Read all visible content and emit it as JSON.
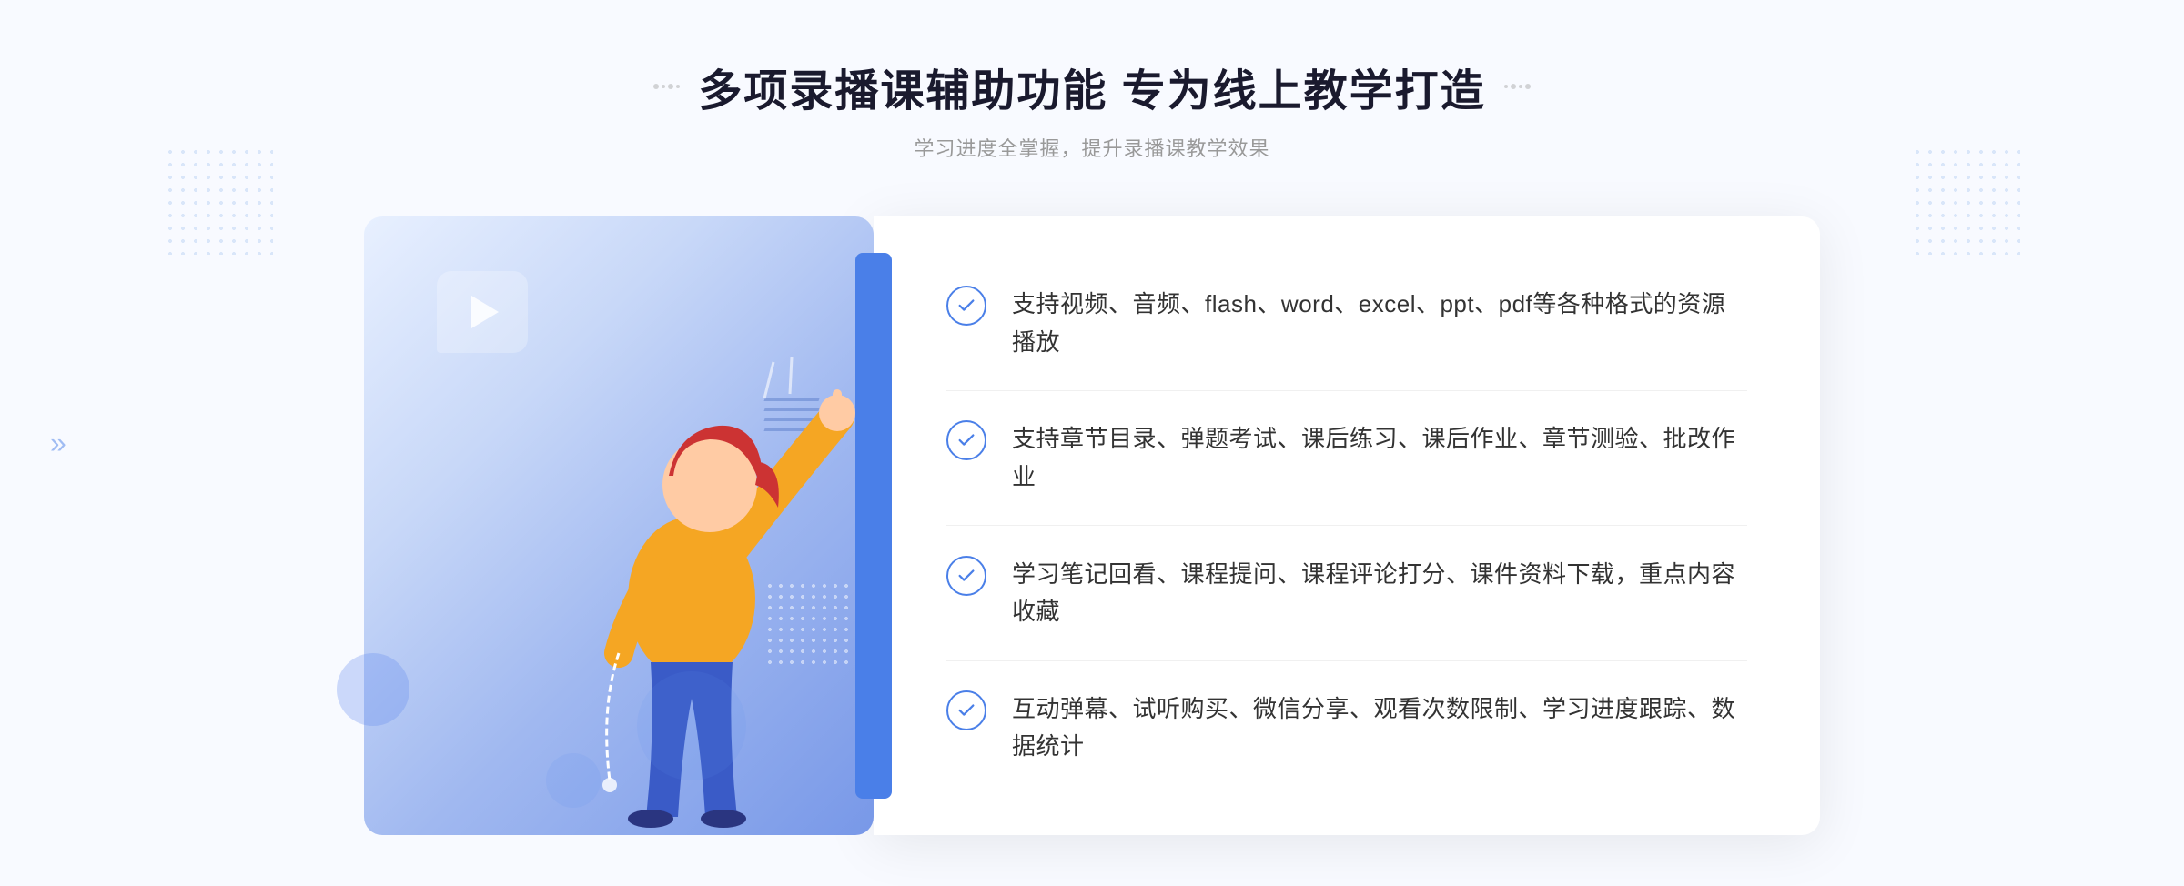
{
  "page": {
    "background": "#f8faff"
  },
  "header": {
    "title": "多项录播课辅助功能 专为线上教学打造",
    "subtitle": "学习进度全掌握，提升录播课教学效果"
  },
  "features": [
    {
      "id": 1,
      "text": "支持视频、音频、flash、word、excel、ppt、pdf等各种格式的资源播放"
    },
    {
      "id": 2,
      "text": "支持章节目录、弹题考试、课后练习、课后作业、章节测验、批改作业"
    },
    {
      "id": 3,
      "text": "学习笔记回看、课程提问、课程评论打分、课件资料下载，重点内容收藏"
    },
    {
      "id": 4,
      "text": "互动弹幕、试听购买、微信分享、观看次数限制、学习进度跟踪、数据统计"
    }
  ],
  "decorators": {
    "left_dots_symbol": "∷",
    "right_dots_symbol": "∷",
    "arrow_symbol": "»"
  }
}
